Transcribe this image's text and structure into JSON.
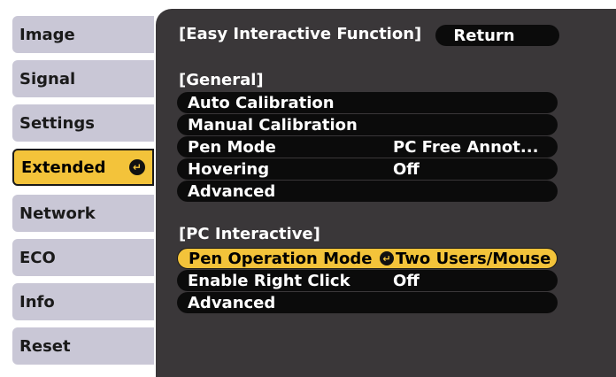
{
  "tabs": [
    {
      "label": "Image"
    },
    {
      "label": "Signal"
    },
    {
      "label": "Settings"
    },
    {
      "label": "Extended",
      "selected": true
    },
    {
      "label": "Network"
    },
    {
      "label": "ECO"
    },
    {
      "label": "Info"
    },
    {
      "label": "Reset"
    }
  ],
  "header": {
    "title": "[Easy Interactive Function]",
    "return_label": "Return"
  },
  "general": {
    "title": "[General]",
    "items": [
      {
        "label": "Auto Calibration",
        "value": ""
      },
      {
        "label": "Manual Calibration",
        "value": ""
      },
      {
        "label": "Pen Mode",
        "value": "PC Free Annot..."
      },
      {
        "label": "Hovering",
        "value": "Off"
      },
      {
        "label": "Advanced",
        "value": ""
      }
    ]
  },
  "pc_interactive": {
    "title": "[PC Interactive]",
    "items": [
      {
        "label": "Pen Operation Mode",
        "value": "Two Users/Mouse",
        "selected": true
      },
      {
        "label": "Enable Right Click",
        "value": "Off"
      },
      {
        "label": "Advanced",
        "value": ""
      }
    ]
  },
  "icons": {
    "enter": "enter-icon"
  },
  "colors": {
    "highlight": "#f3c33a",
    "panel": "#3a3739",
    "tab": "#c9c7d6",
    "row": "#0b0b0b"
  }
}
